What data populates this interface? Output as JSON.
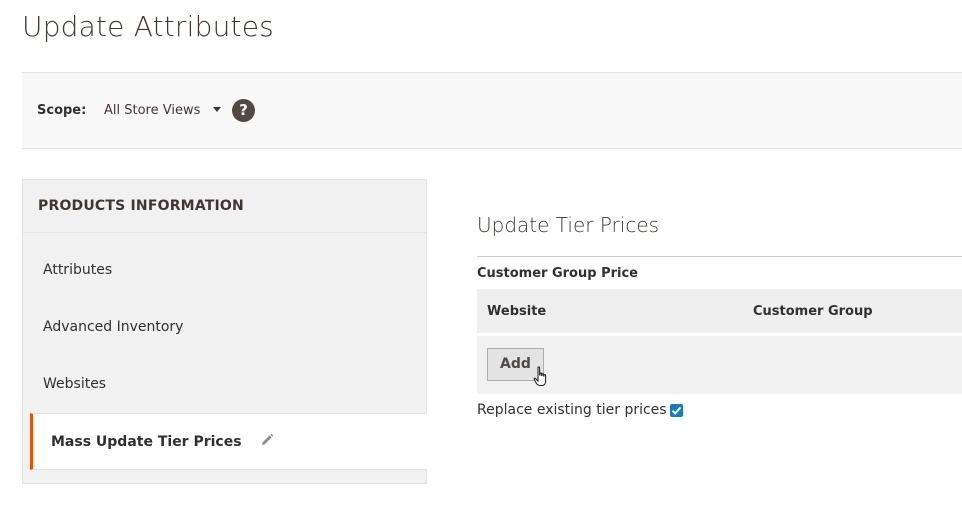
{
  "page": {
    "title": "Update Attributes"
  },
  "scope": {
    "label": "Scope:",
    "selected": "All Store Views",
    "help_glyph": "?"
  },
  "sidebar": {
    "header": "PRODUCTS INFORMATION",
    "items": [
      {
        "label": "Attributes",
        "active": false
      },
      {
        "label": "Advanced Inventory",
        "active": false
      },
      {
        "label": "Websites",
        "active": false
      },
      {
        "label": "Mass Update Tier Prices",
        "active": true
      }
    ]
  },
  "main": {
    "section_title": "Update Tier Prices",
    "group_label": "Customer Group Price",
    "columns": [
      "Website",
      "Customer Group"
    ],
    "add_label": "Add",
    "replace_label": "Replace existing tier prices",
    "replace_checked": true
  },
  "colors": {
    "accent": "#eb5202",
    "checkbox": "#1979c3",
    "help_bg": "#514943"
  },
  "icons": [
    "help-icon",
    "chevron-down-icon",
    "pencil-icon",
    "hand-cursor-icon",
    "checkmark-icon"
  ]
}
